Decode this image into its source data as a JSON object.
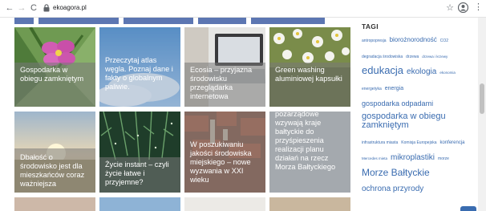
{
  "browser": {
    "url": "ekoagora.pl",
    "nav_back": "←",
    "nav_forward": "→",
    "nav_reload": "C",
    "star": "☆",
    "menu": "⋮",
    "lock_icon": "lock-icon"
  },
  "tiles": [
    {
      "caption": "Gospodarka w obiegu zamkniętym",
      "image": "pink-flower"
    },
    {
      "caption": "Przeczytaj atlas węgla. Poznaj dane i fakty o globalnym paliwie.",
      "image": "blue-sky-cloud"
    },
    {
      "caption": "Ecosia – przyjazna środowisku przeglądarka internetowa",
      "image": "laptop-desk"
    },
    {
      "caption": "Green washing aluminiowej kapsułki",
      "image": "white-flowers"
    },
    {
      "caption": "Dbałość o środowisko jest dla mieszkańców coraz ważniejsza",
      "image": "sunset-over-field"
    },
    {
      "caption": "Życie instant – czyli życie łatwe i przyjemne?",
      "image": "pine-branches"
    },
    {
      "caption": "W poszukiwaniu jakości środowiska miejskiego – nowe wyzwania w XXI wieku",
      "image": "city-rooftops"
    },
    {
      "caption": "pozarządowe wzywają kraje bałtyckie do przyśpieszenia realizacji planu działań na rzecz Morza Bałtyckiego",
      "image": "grey-panel"
    }
  ],
  "sidebar": {
    "title": "TAGI",
    "tags": [
      {
        "label": "antropopresja",
        "size": 5
      },
      {
        "label": "biorożnorodność",
        "size": 8
      },
      {
        "label": "CO2",
        "size": 5
      },
      {
        "label": "degradacja środowiska",
        "size": 5
      },
      {
        "label": "drzewa",
        "size": 5
      },
      {
        "label": "drzewa i krzewy",
        "size": 4.5
      },
      {
        "label": "edukacja",
        "size": 13
      },
      {
        "label": "ekologia",
        "size": 10
      },
      {
        "label": "ekonomia",
        "size": 4.5
      },
      {
        "label": "energetyka",
        "size": 5
      },
      {
        "label": "energia",
        "size": 7
      },
      {
        "label": "gospodarka odpadami",
        "size": 9
      },
      {
        "label": "gospodarka w obiegu zamkniętym",
        "size": 11
      },
      {
        "label": "infrastruktura miasta",
        "size": 5
      },
      {
        "label": "Komisja Europejska",
        "size": 5
      },
      {
        "label": "konferencja",
        "size": 6
      },
      {
        "label": "Mercedes mieta",
        "size": 4.5
      },
      {
        "label": "mikroplastiki",
        "size": 10
      },
      {
        "label": "morze",
        "size": 5
      },
      {
        "label": "Morze Bałtyckie",
        "size": 12
      },
      {
        "label": "ochrona przyrody",
        "size": 10
      }
    ]
  },
  "colors": {
    "accent": "#3a6cb0",
    "nav_strip": "#5c76b2",
    "caption_overlay": "rgba(120,120,120,0.55)"
  }
}
